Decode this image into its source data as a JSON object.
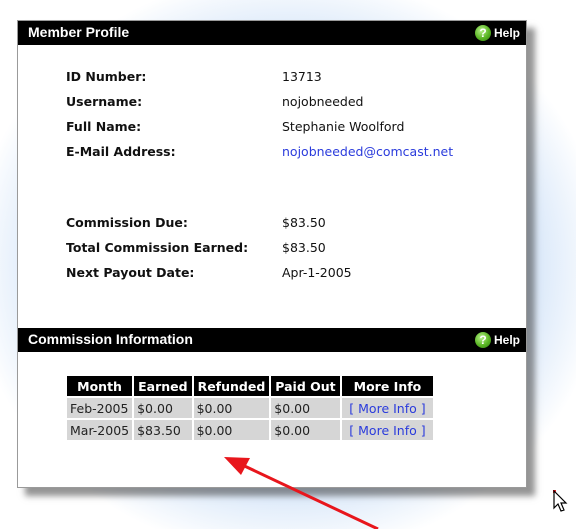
{
  "profile": {
    "title": "Member Profile",
    "help": "Help",
    "fields": [
      {
        "label": "ID Number:",
        "value": "13713"
      },
      {
        "label": "Username:",
        "value": "nojobneeded"
      },
      {
        "label": "Full Name:",
        "value": "Stephanie Woolford"
      },
      {
        "label": "E-Mail Address:",
        "value": "nojobneeded@comcast.net"
      },
      {
        "label": "Commission Due:",
        "value": "$83.50"
      },
      {
        "label": "Total Commission Earned:",
        "value": "$83.50"
      },
      {
        "label": "Next Payout Date:",
        "value": "Apr-1-2005"
      }
    ]
  },
  "commission": {
    "title": "Commission Information",
    "help": "Help",
    "headers": [
      "Month",
      "Earned",
      "Refunded",
      "Paid Out",
      "More Info"
    ],
    "rows": [
      [
        "Feb-2005",
        "$0.00",
        "$0.00",
        "$0.00",
        "[ More Info ]"
      ],
      [
        "Mar-2005",
        "$83.50",
        "$0.00",
        "$0.00",
        "[ More Info ]"
      ]
    ]
  },
  "colors": {
    "link": "#2a3bdc",
    "header_bar": "#000000",
    "table_cell": "#d6d6d6",
    "annotation_arrow": "#e8161c"
  },
  "icons": [
    "help-icon",
    "mouse-cursor-icon",
    "red-arrow-annotation"
  ]
}
